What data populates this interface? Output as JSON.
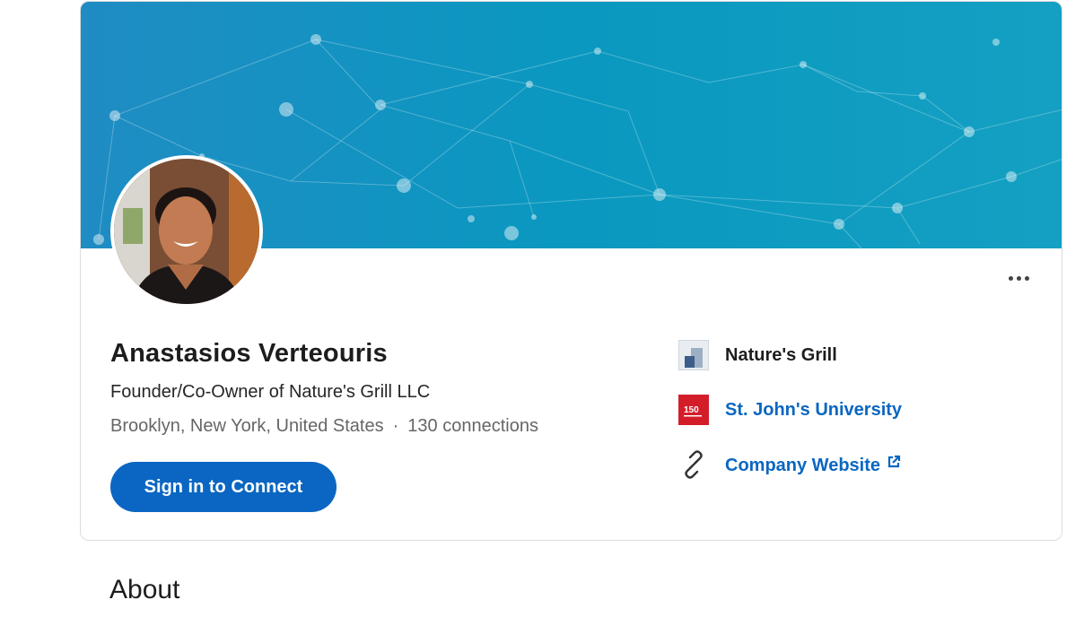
{
  "profile": {
    "name": "Anastasios Verteouris",
    "headline": "Founder/Co-Owner of Nature's Grill LLC",
    "location": "Brooklyn, New York, United States",
    "separator": "·",
    "connections": "130 connections",
    "connect_label": "Sign in to Connect",
    "more_icon": "more-horizontal-icon"
  },
  "side": {
    "company": {
      "label": "Nature's Grill",
      "icon": "company-logo-icon"
    },
    "school": {
      "label": "St. John's University",
      "icon": "university-logo-icon",
      "logo_text": "150"
    },
    "website": {
      "label": "Company Website",
      "icon": "link-icon",
      "ext_icon": "external-link-icon"
    }
  },
  "section": {
    "about_title": "About"
  },
  "colors": {
    "accent": "#0a66c2",
    "banner": "#0a98c0",
    "school_red": "#d31e2a"
  }
}
